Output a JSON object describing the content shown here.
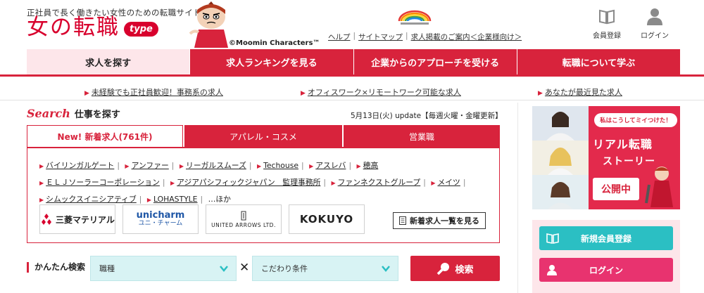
{
  "header": {
    "tagline": "正社員で長く働きたい女性のための転職サイト",
    "logo_text": "女の転職",
    "logo_badge": "type",
    "copyright": "©Moomin Characters™",
    "links": [
      "ヘルプ",
      "サイトマップ",
      "求人掲載のご案内＜企業様向け＞"
    ],
    "register_label": "会員登録",
    "login_label": "ログイン"
  },
  "nav": {
    "items": [
      "求人を探す",
      "求人ランキングを見る",
      "企業からのアプローチを受ける",
      "転職について学ぶ"
    ]
  },
  "notices": [
    "未経験でも正社員歓迎！事務系の求人",
    "オフィスワーク×リモートワーク可能な求人",
    "あなたが最近見た求人"
  ],
  "search": {
    "label_word": "Search",
    "title": "仕事を探す",
    "update": "5月13日(火) update【毎週火曜・金曜更新】"
  },
  "tabs": [
    "New! 新着求人(761件)",
    "アパレル・コスメ",
    "営業職"
  ],
  "companies": [
    "バイリンガルゲート",
    "アンファー",
    "リーガルスムーズ",
    "Techouse",
    "アスレバ",
    "穂高",
    "ＥＬＪソーラーコーポレーション",
    "アジアパシフィックジャパン　監理事務所",
    "ファンネクストグループ",
    "メイツ",
    "シムックスイニシアティブ",
    "LOHASTYLE"
  ],
  "companies_more": "…ほか",
  "logos": [
    "三菱マテリアル",
    "unicharm",
    "ユニ・チャーム",
    "UNITED ARROWS LTD.",
    "KOKUYO"
  ],
  "all_new_label": "新着求人一覧を見る",
  "easy_search": {
    "label": "かんたん検索",
    "job_type": "職種",
    "conditions": "こだわり条件",
    "button": "検索"
  },
  "banner": {
    "small": "私はこうしてミイつけた！",
    "title1": "リアル転職",
    "title2": "ストーリー",
    "open": "公開中"
  },
  "member": {
    "register": "新規会員登録",
    "login": "ログイン"
  },
  "colors": {
    "brand_red": "#d8233c",
    "teal": "#2bbfc3",
    "pink": "#e8336f"
  }
}
